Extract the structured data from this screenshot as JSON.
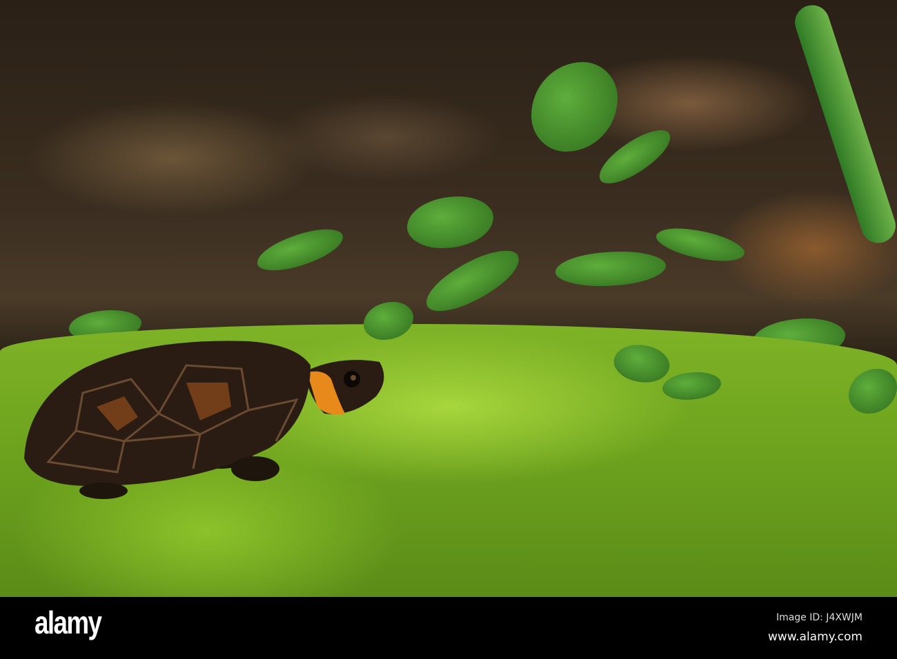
{
  "footer": {
    "logo": "alamy",
    "image_id": "Image ID: J4XWJM",
    "website": "www.alamy.com"
  },
  "colors": {
    "moss": "#8cc22a",
    "shell": "#2a1c12",
    "neck_patch": "#e8891c",
    "footer": "#000000"
  }
}
